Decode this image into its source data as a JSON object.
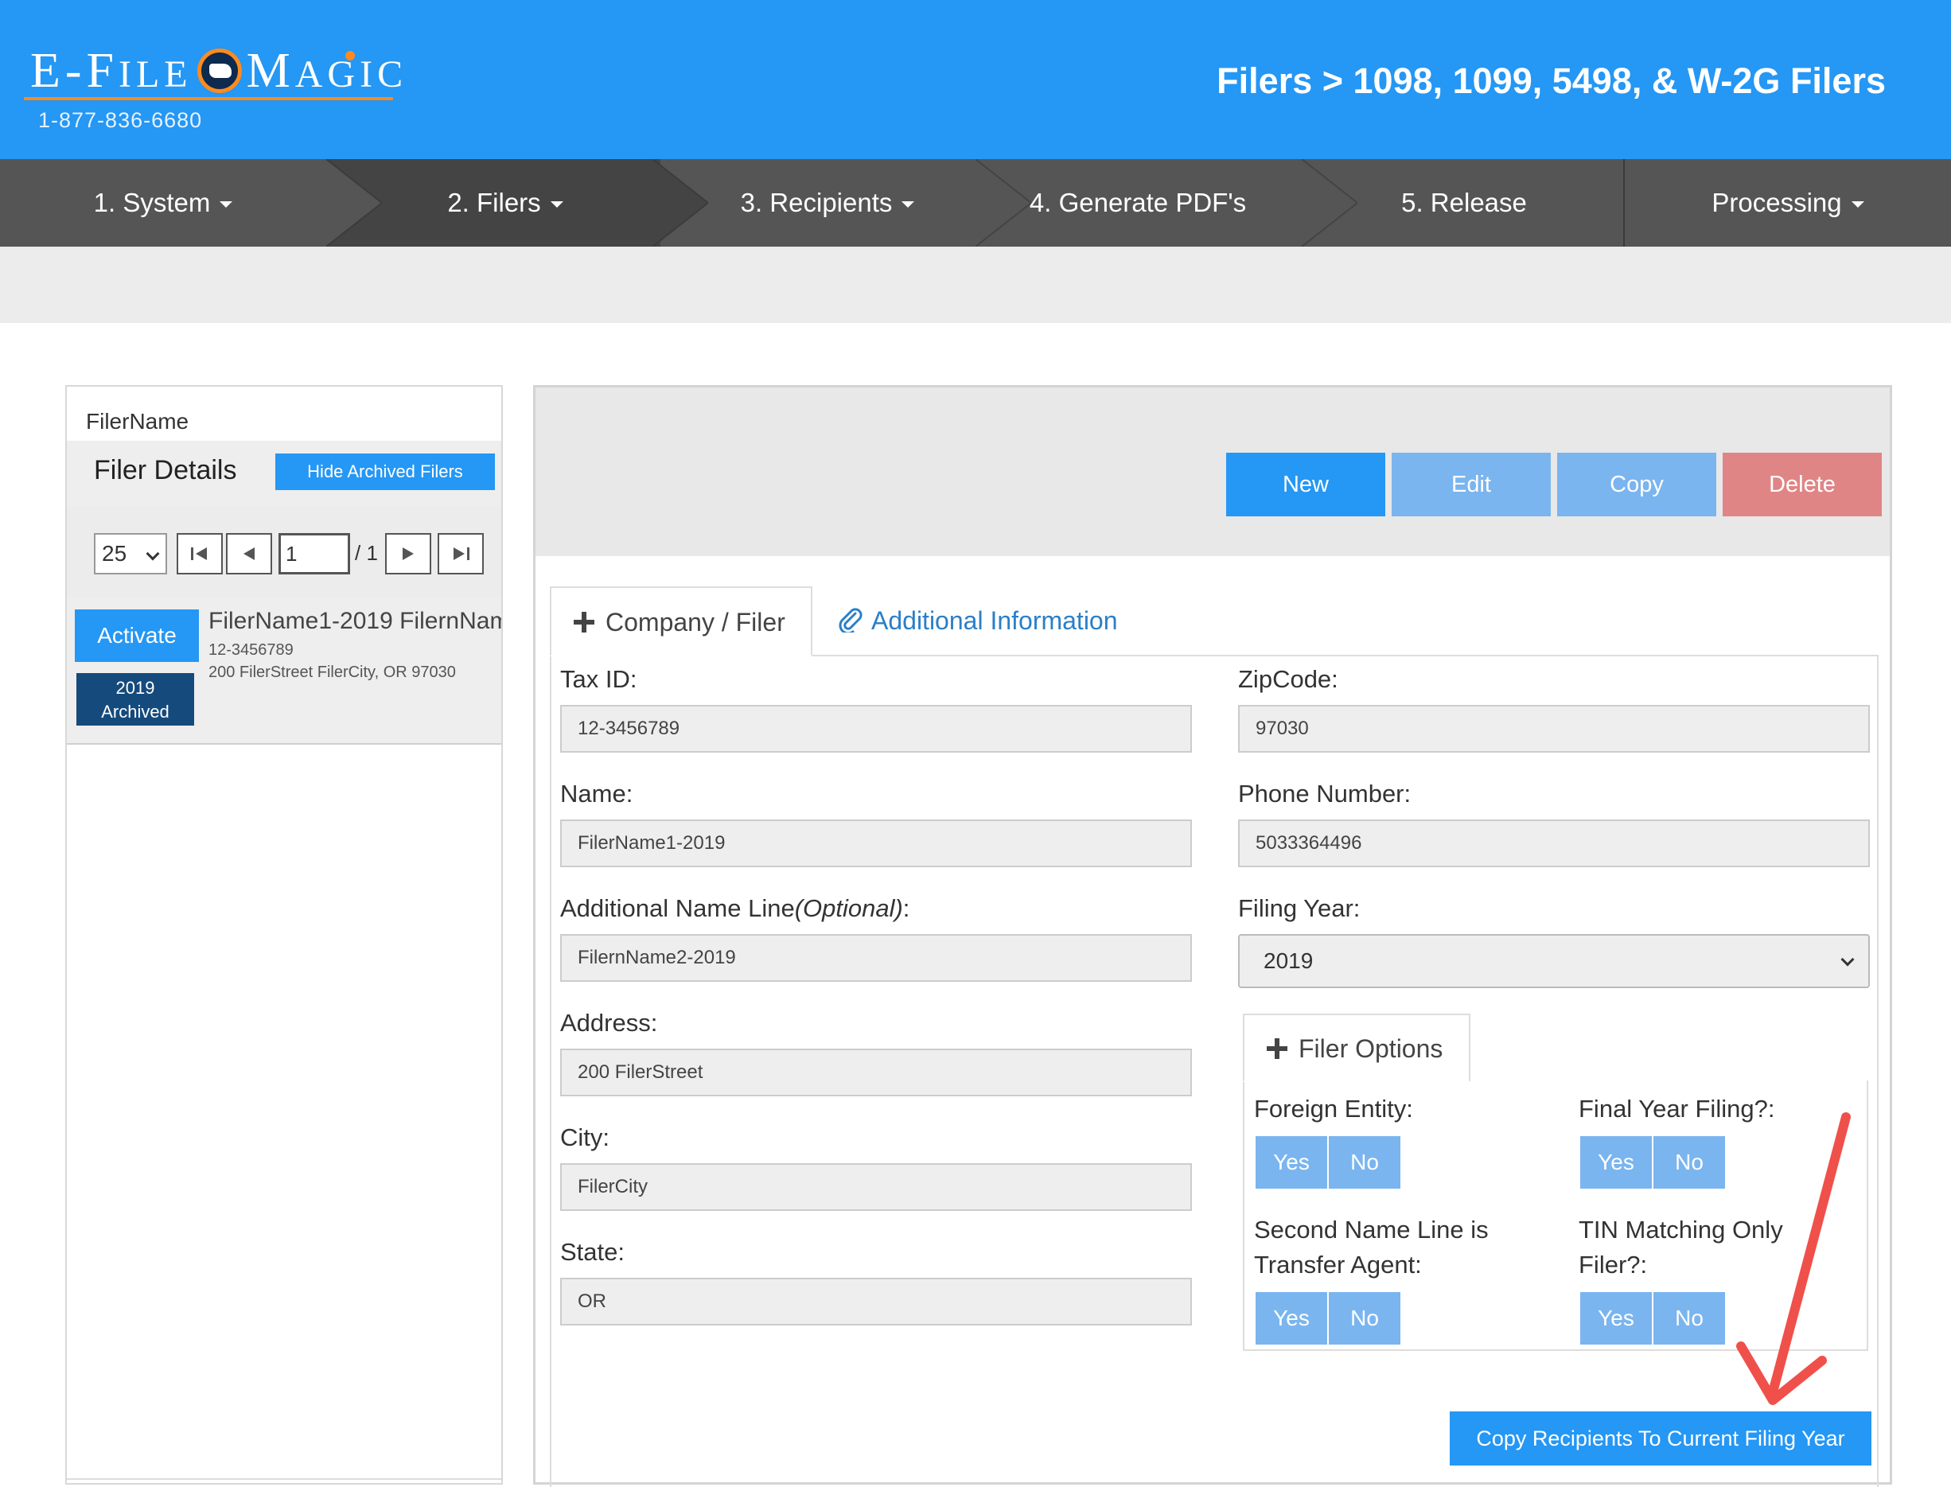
{
  "header": {
    "logo_text": "E-File Magic",
    "phone": "1-877-836-6680",
    "breadcrumb": "Filers > 1098, 1099, 5498, & W-2G Filers",
    "accent_color": "#2597f4",
    "logo_accent_color": "#ff8a1e"
  },
  "nav": {
    "items": [
      {
        "label": "1. System",
        "has_caret": true
      },
      {
        "label": "2. Filers",
        "has_caret": true
      },
      {
        "label": "3. Recipients",
        "has_caret": true
      },
      {
        "label": "4. Generate PDF's",
        "has_caret": false
      },
      {
        "label": "5. Release",
        "has_caret": false
      },
      {
        "label": "Processing",
        "has_caret": true
      }
    ]
  },
  "left_panel": {
    "column_header": "FilerName",
    "title": "Filer Details",
    "hide_archived_label": "Hide Archived Filers",
    "page_size": "25",
    "current_page": "1",
    "total_pages": "/ 1",
    "record": {
      "activate_label": "Activate",
      "badge_year": "2019",
      "badge_status": "Archived",
      "name": "FilerName1-2019 FilernName2-2019",
      "tin": "12-3456789",
      "address": "200 FilerStreet FilerCity, OR 97030"
    }
  },
  "toolbar": {
    "new_label": "New",
    "edit_label": "Edit",
    "copy_label": "Copy",
    "delete_label": "Delete"
  },
  "tabs": {
    "company_filer": "Company / Filer",
    "additional_info": "Additional Information"
  },
  "form": {
    "tax_id_label": "Tax ID:",
    "tax_id_value": "12-3456789",
    "name_label": "Name:",
    "name_value": "FilerName1-2019",
    "addl_name_label": "Additional Name Line",
    "addl_name_optional": "(Optional)",
    "addl_name_colon": ":",
    "addl_name_value": "FilernName2-2019",
    "address_label": "Address:",
    "address_value": "200 FilerStreet",
    "city_label": "City:",
    "city_value": "FilerCity",
    "state_label": "State:",
    "state_value": "OR",
    "zip_label": "ZipCode:",
    "zip_value": "97030",
    "phone_label": "Phone Number:",
    "phone_value": "5033364496",
    "filing_year_label": "Filing Year:",
    "filing_year_value": "2019"
  },
  "filer_options": {
    "tab_label": "Filer Options",
    "foreign_entity_label": "Foreign Entity:",
    "final_year_label": "Final Year Filing?:",
    "second_name_label_1": "Second Name Line is",
    "second_name_label_2": "Transfer Agent:",
    "tin_matching_label_1": "TIN Matching Only",
    "tin_matching_label_2": "Filer?:",
    "yes": "Yes",
    "no": "No"
  },
  "copy_recipients_label": "Copy Recipients To Current Filing Year"
}
